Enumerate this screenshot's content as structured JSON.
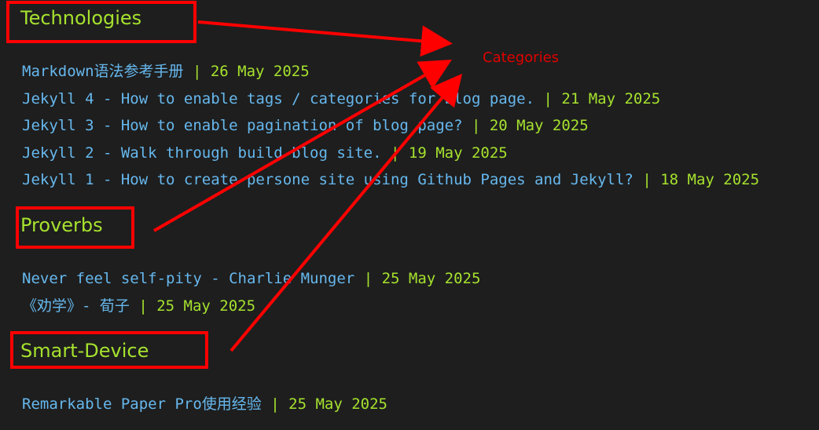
{
  "categories": [
    {
      "name": "Technologies",
      "posts": [
        {
          "title": "Markdown语法参考手册",
          "date": "26 May 2025"
        },
        {
          "title": "Jekyll 4 - How to enable tags / categories for blog page.",
          "date": "21 May 2025"
        },
        {
          "title": "Jekyll 3 - How to enable pagination of blog page?",
          "date": "20 May 2025"
        },
        {
          "title": "Jekyll 2 - Walk through build blog site.",
          "date": "19 May 2025"
        },
        {
          "title": "Jekyll 1 - How to create persone site using Github Pages and Jekyll?",
          "date": "18 May 2025"
        }
      ]
    },
    {
      "name": "Proverbs",
      "posts": [
        {
          "title": "Never feel self-pity - Charlie Munger",
          "date": "25 May 2025"
        },
        {
          "title": "《劝学》- 荀子",
          "date": "25 May 2025"
        }
      ]
    },
    {
      "name": "Smart-Device",
      "posts": [
        {
          "title": "Remarkable Paper Pro使用经验",
          "date": "25 May 2025"
        }
      ]
    }
  ],
  "separator": "|",
  "annotation": {
    "label": "Categories",
    "color": "#ff0000"
  },
  "colors": {
    "background": "#1e1e1e",
    "heading": "#a6e22e",
    "link": "#66b8ee",
    "date": "#a6e22e"
  }
}
